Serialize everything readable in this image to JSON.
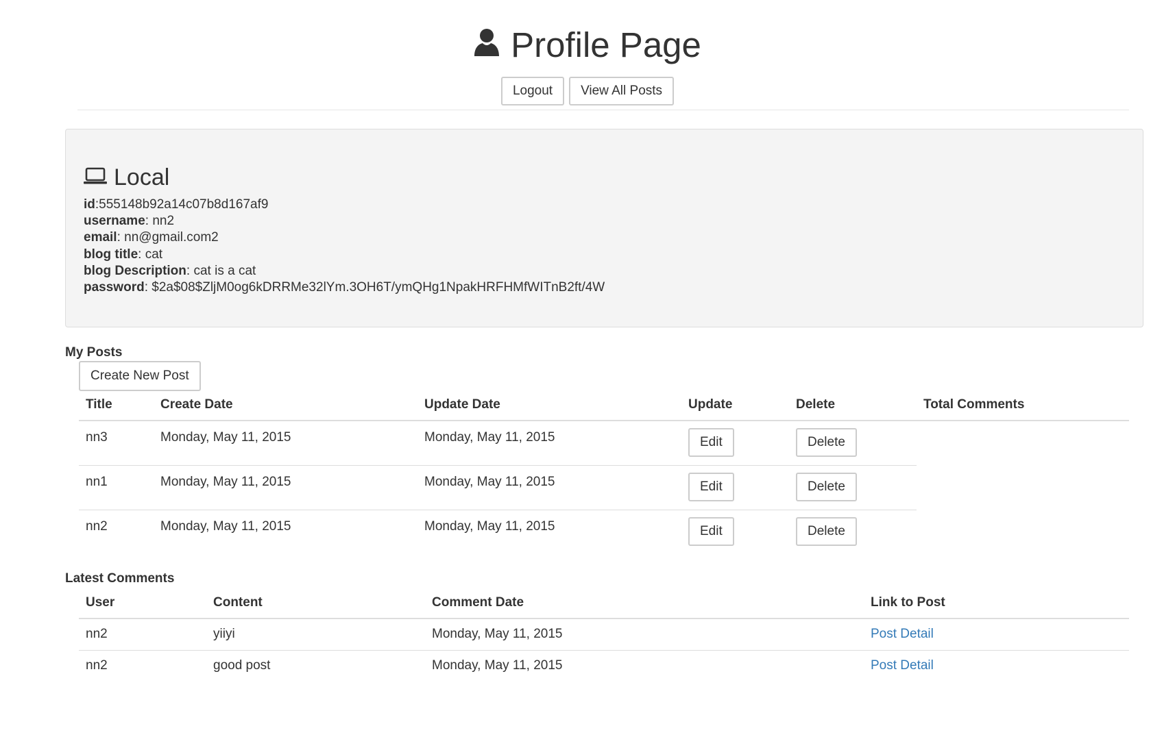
{
  "header": {
    "title": "Profile Page",
    "logout_label": "Logout",
    "view_all_posts_label": "View All Posts",
    "title_icon": "user-icon"
  },
  "local": {
    "title": "Local",
    "icon": "laptop-icon",
    "fields": [
      {
        "key": "id",
        "sep": ":",
        "value": "555148b92a14c07b8d167af9"
      },
      {
        "key": "username",
        "sep": ": ",
        "value": "nn2"
      },
      {
        "key": "email",
        "sep": ": ",
        "value": "nn@gmail.com2"
      },
      {
        "key": "blog title",
        "sep": ": ",
        "value": "cat"
      },
      {
        "key": "blog Description",
        "sep": ": ",
        "value": "cat is a cat"
      },
      {
        "key": "password",
        "sep": ": ",
        "value": "$2a$08$ZljM0og6kDRRMe32lYm.3OH6T/ymQHg1NpakHRFHMfWITnB2ft/4W"
      }
    ]
  },
  "my_posts": {
    "label": "My Posts",
    "create_button": "Create New Post",
    "columns": [
      "Title",
      "Create Date",
      "Update Date",
      "Update",
      "Delete",
      "Total Comments"
    ],
    "rows": [
      {
        "title": "nn3",
        "create_date": "Monday, May 11, 2015",
        "update_date": "Monday, May 11, 2015",
        "edit": "Edit",
        "delete": "Delete"
      },
      {
        "title": "nn1",
        "create_date": "Monday, May 11, 2015",
        "update_date": "Monday, May 11, 2015",
        "edit": "Edit",
        "delete": "Delete"
      },
      {
        "title": "nn2",
        "create_date": "Monday, May 11, 2015",
        "update_date": "Monday, May 11, 2015",
        "edit": "Edit",
        "delete": "Delete"
      }
    ]
  },
  "latest_comments": {
    "label": "Latest Comments",
    "columns": [
      "User",
      "Content",
      "Comment Date",
      "Link to Post"
    ],
    "rows": [
      {
        "user": "nn2",
        "content": "yiiyi",
        "date": "Monday, May 11, 2015",
        "link": "Post Detail"
      },
      {
        "user": "nn2",
        "content": "good post",
        "date": "Monday, May 11, 2015",
        "link": "Post Detail"
      }
    ]
  },
  "colors": {
    "link": "#337ab7",
    "well_bg": "#f4f4f4",
    "text": "#333333"
  }
}
